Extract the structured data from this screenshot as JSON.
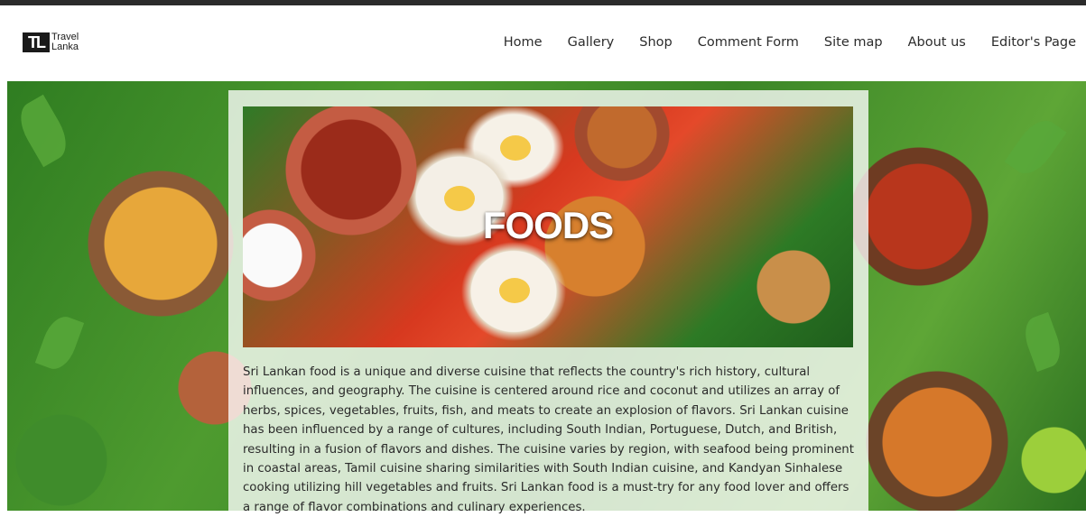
{
  "logo": {
    "mark": "TL",
    "line1": "Travel",
    "line2": "Lanka"
  },
  "nav": {
    "items": [
      {
        "label": "Home"
      },
      {
        "label": "Gallery"
      },
      {
        "label": "Shop"
      },
      {
        "label": "Comment Form"
      },
      {
        "label": "Site map"
      },
      {
        "label": "About us"
      },
      {
        "label": "Editor's Page"
      }
    ]
  },
  "banner": {
    "title": "FOODS"
  },
  "article": {
    "text": "Sri Lankan food is a unique and diverse cuisine that reflects the country's rich history, cultural influences, and geography. The cuisine is centered around rice and coconut and utilizes an array of herbs, spices, vegetables, fruits, fish, and meats to create an explosion of flavors. Sri Lankan cuisine has been influenced by a range of cultures, including South Indian, Portuguese, Dutch, and British, resulting in a fusion of flavors and dishes. The cuisine varies by region, with seafood being prominent in coastal areas, Tamil cuisine sharing similarities with South Indian cuisine, and Kandyan Sinhalese cooking utilizing hill vegetables and fruits. Sri Lankan food is a must-try for any food lover and offers a range of flavor combinations and culinary experiences."
  }
}
